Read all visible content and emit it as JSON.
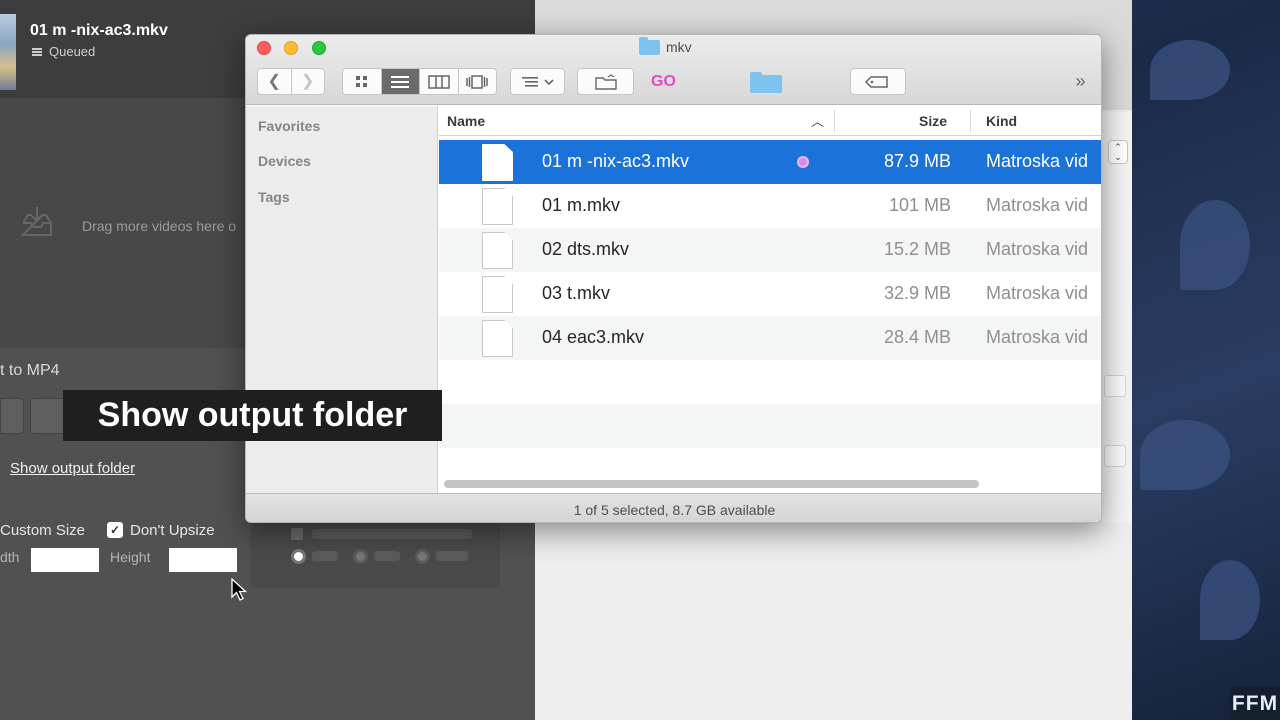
{
  "converter": {
    "file_title": "01 m -nix-ac3.mkv",
    "file_status": "Queued",
    "drop_hint": "Drag more videos here o",
    "format_label": "t to MP4",
    "show_output_link": "Show output folder",
    "custom_size_label": "Custom Size",
    "dont_upsize_label": "Don't Upsize",
    "dont_upsize_checked": true,
    "width_label": "dth",
    "height_label": "Height",
    "width_value": "",
    "height_value": ""
  },
  "finder": {
    "title": "mkv",
    "toolbar": {
      "back": "❮",
      "forward": "❯",
      "go_label": "GO",
      "more": "»"
    },
    "sidebar": [
      "Favorites",
      "Devices",
      "Tags"
    ],
    "columns": {
      "name": "Name",
      "size": "Size",
      "kind": "Kind"
    },
    "files": [
      {
        "name": "01 m -nix-ac3.mkv",
        "size": "87.9 MB",
        "kind": "Matroska vid",
        "selected": true,
        "tag_color": "#d58ce8"
      },
      {
        "name": "01 m.mkv",
        "size": "101 MB",
        "kind": "Matroska vid",
        "selected": false
      },
      {
        "name": "02 dts.mkv",
        "size": "15.2 MB",
        "kind": "Matroska vid",
        "selected": false
      },
      {
        "name": "03 t.mkv",
        "size": "32.9 MB",
        "kind": "Matroska vid",
        "selected": false
      },
      {
        "name": "04 eac3.mkv",
        "size": "28.4 MB",
        "kind": "Matroska vid",
        "selected": false
      }
    ],
    "status": "1 of 5 selected, 8.7 GB available"
  },
  "caption": "Show output folder",
  "watermark": "FFM",
  "colors": {
    "selection": "#1b72d8",
    "go": "#e34abf",
    "tag": "#d58ce8"
  }
}
